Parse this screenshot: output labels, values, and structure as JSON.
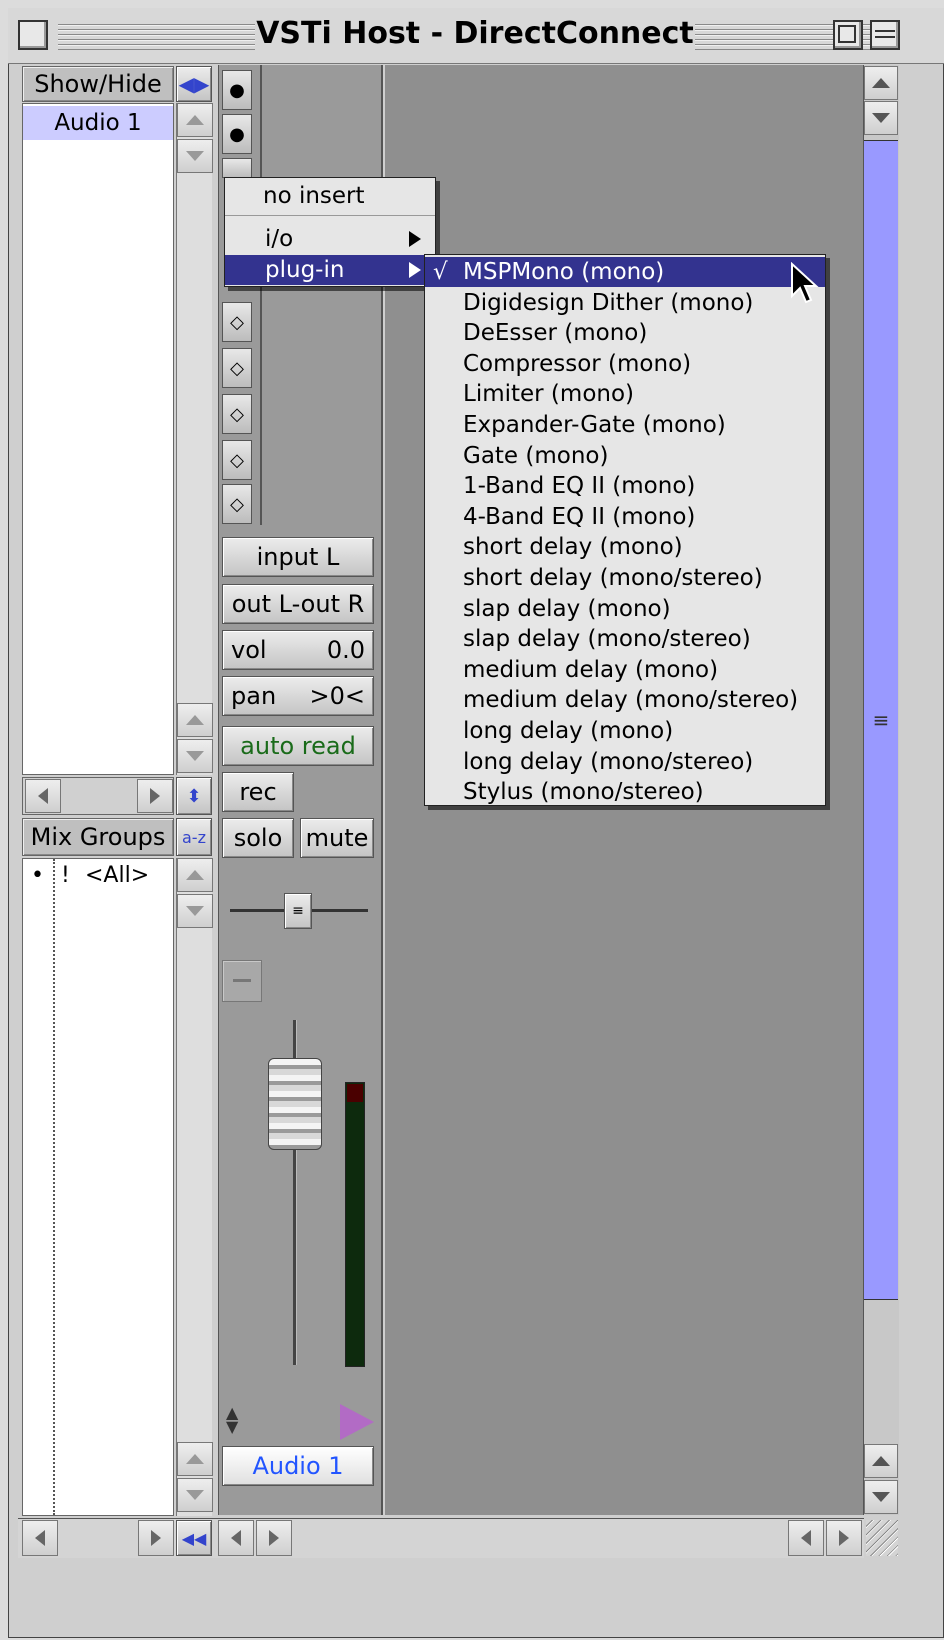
{
  "window": {
    "title": "VSTi Host - DirectConnect"
  },
  "show_hide": {
    "header": "Show/Hide",
    "tracks": [
      "Audio 1"
    ]
  },
  "mix_groups": {
    "header": "Mix Groups",
    "sort_icon": "a-z",
    "items": [
      {
        "bullet": "•",
        "flag": "!",
        "name": "<All>"
      }
    ]
  },
  "channel": {
    "input_label": "input L",
    "output_label": "out L-out R",
    "vol_label": "vol",
    "vol_value": "0.0",
    "pan_label": "pan",
    "pan_value": ">0<",
    "automation_label": "auto read",
    "rec_label": "rec",
    "solo_label": "solo",
    "mute_label": "mute",
    "name_label": "Audio 1"
  },
  "insert_menu": {
    "items": [
      {
        "label": "no insert"
      },
      {
        "label": "i/o"
      },
      {
        "label": "plug-in"
      }
    ]
  },
  "plugin_menu": {
    "checked_mark": "√",
    "items": [
      "MSPMono (mono)",
      "Digidesign Dither (mono)",
      "DeEsser (mono)",
      "Compressor (mono)",
      "Limiter (mono)",
      "Expander-Gate (mono)",
      "Gate (mono)",
      "1-Band EQ II (mono)",
      "4-Band EQ II (mono)",
      "short delay (mono)",
      "short delay (mono/stereo)",
      "slap delay (mono)",
      "slap delay (mono/stereo)",
      "medium delay (mono)",
      "medium delay (mono/stereo)",
      "long delay (mono)",
      "long delay (mono/stereo)",
      "Stylus (mono/stereo)"
    ]
  },
  "colors": {
    "selection": "#33338f",
    "scroll_thumb": "#9999ff",
    "name_text": "#2255ff",
    "auto_text": "#1a6b1a"
  }
}
